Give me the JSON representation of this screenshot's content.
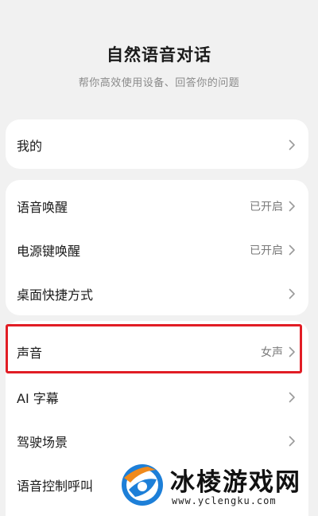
{
  "header": {
    "title": "自然语音对话",
    "subtitle": "帮你高效使用设备、回答你的问题"
  },
  "groups": [
    {
      "items": [
        {
          "label": "我的",
          "value": ""
        }
      ]
    },
    {
      "items": [
        {
          "label": "语音唤醒",
          "value": "已开启"
        },
        {
          "label": "电源键唤醒",
          "value": "已开启"
        },
        {
          "label": "桌面快捷方式",
          "value": ""
        }
      ]
    },
    {
      "items": [
        {
          "label": "声音",
          "value": "女声"
        },
        {
          "label": "AI 字幕",
          "value": ""
        },
        {
          "label": "驾驶场景",
          "value": ""
        },
        {
          "label": "语音控制呼叫",
          "value": ""
        }
      ]
    }
  ],
  "highlight_color": "#e11d25",
  "watermark": {
    "text": "冰棱游戏网",
    "url": "www.yclengku.com"
  },
  "icons": {
    "chevron": "chevron-right-icon",
    "logo": "watermark-logo-icon"
  }
}
